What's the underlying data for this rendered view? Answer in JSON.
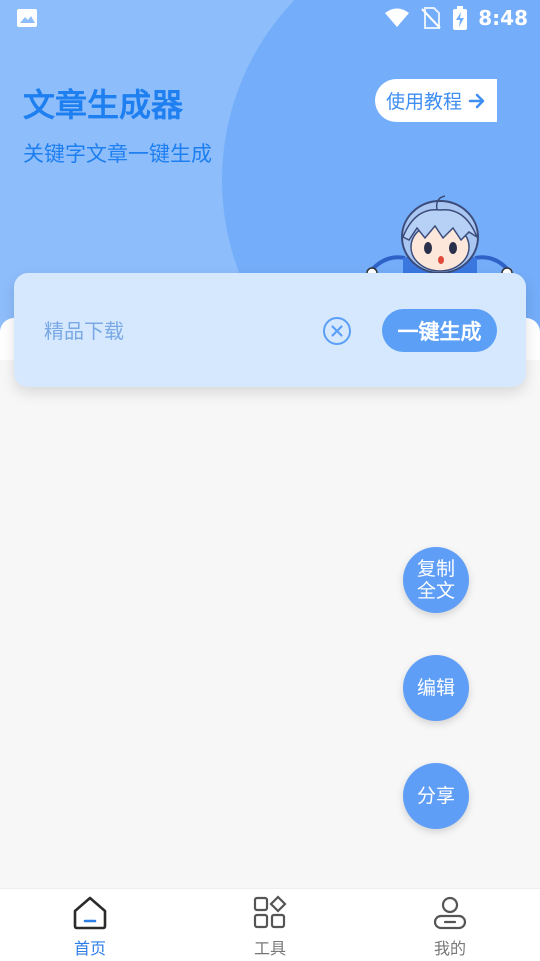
{
  "status_bar": {
    "time": "8:48",
    "icons": [
      "image-icon",
      "wifi-icon",
      "no-sim-icon",
      "battery-charging-icon"
    ]
  },
  "header": {
    "title": "文章生成器",
    "subtitle": "关键字文章一键生成",
    "tutorial_label": "使用教程"
  },
  "search": {
    "placeholder": "精品下载",
    "generate_label": "一键生成"
  },
  "actions": {
    "copy_line1": "复制",
    "copy_line2": "全文",
    "edit_label": "编辑",
    "share_label": "分享"
  },
  "bottom_nav": {
    "items": [
      {
        "label": "首页",
        "icon": "home-icon",
        "active": true
      },
      {
        "label": "工具",
        "icon": "grid-icon",
        "active": false
      },
      {
        "label": "我的",
        "icon": "user-icon",
        "active": false
      }
    ]
  },
  "colors": {
    "accent": "#1e7ff0",
    "hero_bg": "#8ebdfb",
    "hero_circle": "#74adf9",
    "card_bg": "#d6e8fe",
    "fab_bg": "#5f9ef6",
    "nav_active": "#2f7fe8"
  }
}
